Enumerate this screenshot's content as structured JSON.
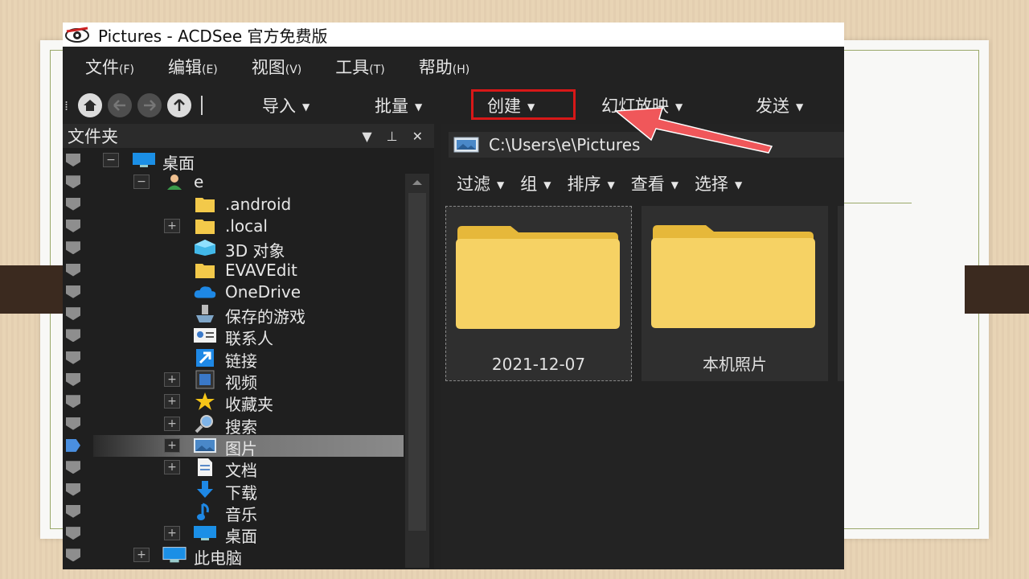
{
  "window": {
    "title": "Pictures - ACDSee 官方免费版"
  },
  "menu": [
    {
      "label": "文件",
      "key": "(F)"
    },
    {
      "label": "编辑",
      "key": "(E)"
    },
    {
      "label": "视图",
      "key": "(V)"
    },
    {
      "label": "工具",
      "key": "(T)"
    },
    {
      "label": "帮助",
      "key": "(H)"
    }
  ],
  "toolbar": {
    "import": "导入",
    "batch": "批量",
    "create": "创建",
    "slideshow": "幻灯放映",
    "send": "发送"
  },
  "folders_panel": {
    "title": "文件夹"
  },
  "tree": [
    {
      "label": "桌面",
      "icon": "desktop-icon",
      "expander": "−"
    },
    {
      "label": "e",
      "icon": "user-icon",
      "expander": "−"
    },
    {
      "label": ".android",
      "icon": "folder-icon"
    },
    {
      "label": ".local",
      "icon": "folder-icon",
      "expander": "+"
    },
    {
      "label": "3D 对象",
      "icon": "3d-objects-icon"
    },
    {
      "label": "EVAVEdit",
      "icon": "folder-icon"
    },
    {
      "label": "OneDrive",
      "icon": "cloud-icon"
    },
    {
      "label": "保存的游戏",
      "icon": "saved-games-icon"
    },
    {
      "label": "联系人",
      "icon": "contacts-icon"
    },
    {
      "label": "链接",
      "icon": "link-icon"
    },
    {
      "label": "视频",
      "icon": "video-icon",
      "expander": "+"
    },
    {
      "label": "收藏夹",
      "icon": "star-icon",
      "expander": "+"
    },
    {
      "label": "搜索",
      "icon": "search-icon",
      "expander": "+"
    },
    {
      "label": "图片",
      "icon": "pictures-icon",
      "expander": "+",
      "selected": true
    },
    {
      "label": "文档",
      "icon": "documents-icon",
      "expander": "+"
    },
    {
      "label": "下载",
      "icon": "download-icon"
    },
    {
      "label": "音乐",
      "icon": "music-icon"
    },
    {
      "label": "桌面",
      "icon": "desktop-icon",
      "expander": "+"
    },
    {
      "label": "此电脑",
      "icon": "computer-icon",
      "expander": "+"
    }
  ],
  "path": {
    "value": "C:\\Users\\e\\Pictures"
  },
  "filterbar": {
    "filter": "过滤",
    "group": "组",
    "sort": "排序",
    "view": "查看",
    "select": "选择"
  },
  "thumbnails": [
    {
      "label": "2021-12-07"
    },
    {
      "label": "本机照片"
    }
  ],
  "colors": {
    "accent_highlight": "#d81818",
    "arrow": "#f0575a",
    "window_bg": "#222222",
    "folder": "#f3c94a"
  }
}
